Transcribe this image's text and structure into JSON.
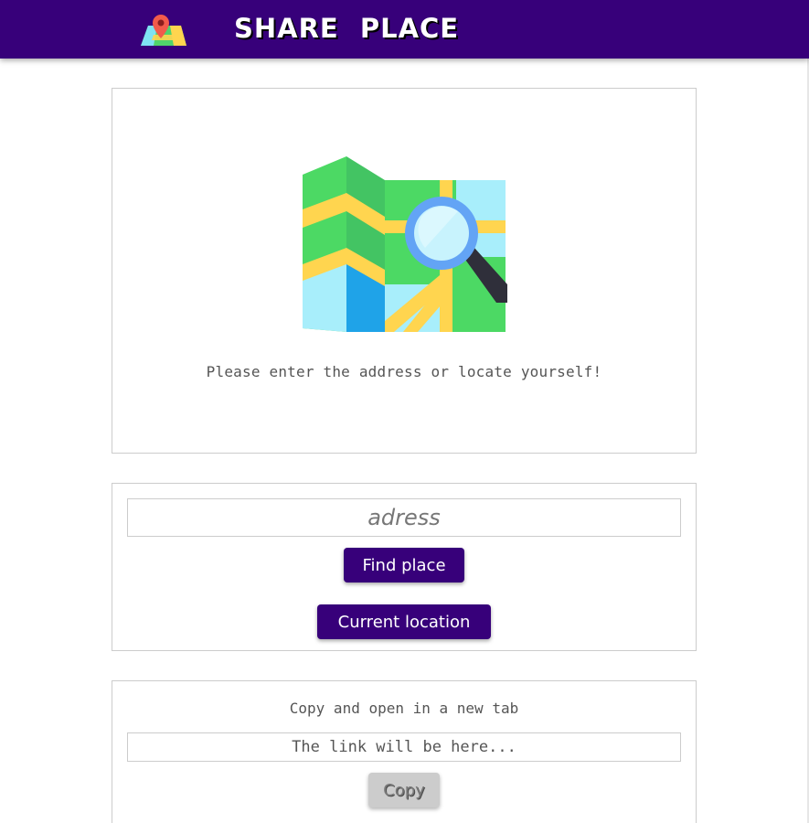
{
  "header": {
    "title": "SHARE PLACE",
    "logo_icon": "map-pin-icon",
    "background": "#37007a"
  },
  "map_panel": {
    "illustration_icon": "map-search-icon",
    "hint": "Please enter the address or locate yourself!"
  },
  "search": {
    "placeholder": "adress",
    "value": "",
    "find_label": "Find place",
    "current_location_label": "Current location",
    "button_color": "#37007a"
  },
  "share": {
    "label": "Copy and open in a new tab",
    "link_placeholder": "The link will be here...",
    "copy_label": "Copy",
    "copy_disabled": true
  }
}
